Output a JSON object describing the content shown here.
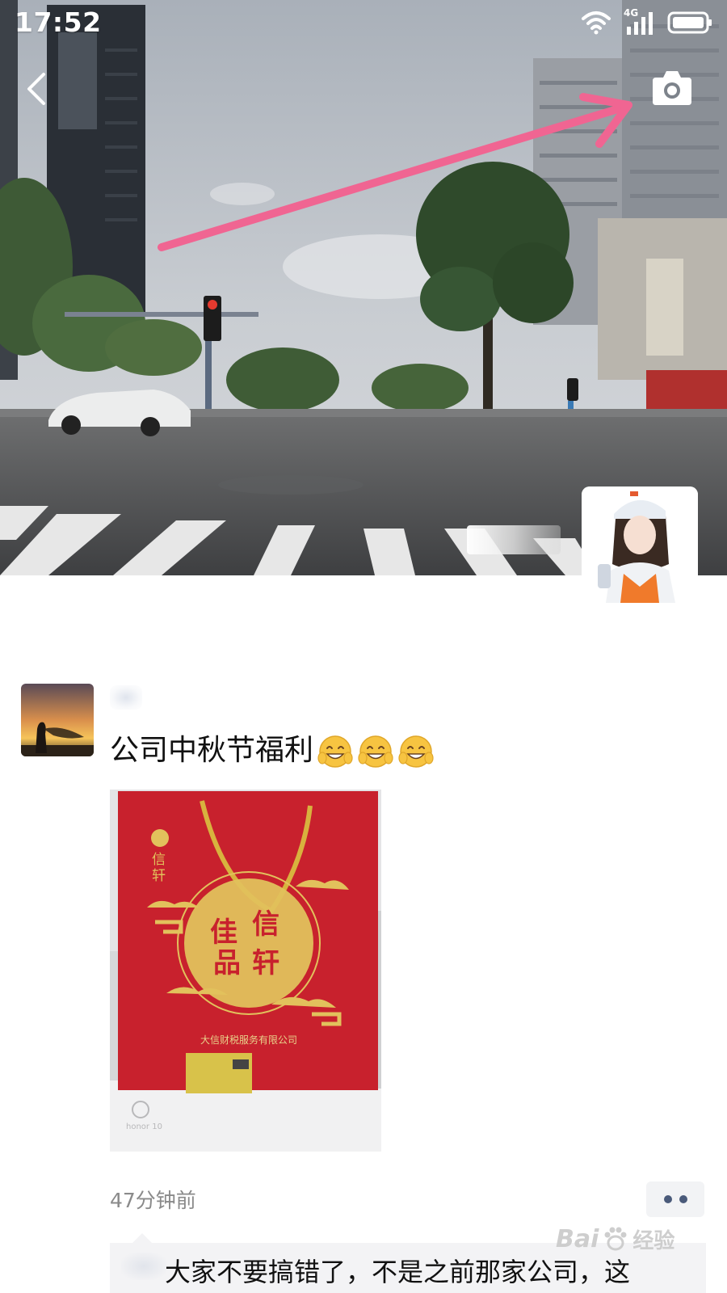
{
  "status_bar": {
    "time": "17:52",
    "network": "4G",
    "icons": [
      "wifi-icon",
      "signal-icon",
      "battery-icon"
    ]
  },
  "cover": {
    "back_icon": "chevron-left-icon",
    "camera_icon": "camera-icon",
    "annotation": "pink-arrow-pointing-to-camera"
  },
  "post": {
    "text": "公司中秋节福利",
    "emoji_icons": [
      "grin-sweat-emoji",
      "grin-sweat-emoji",
      "grin-sweat-emoji"
    ],
    "time_ago": "47分钟前",
    "image": {
      "bag_brand": "信轩",
      "bag_center": [
        "佳",
        "信",
        "品",
        "轩"
      ],
      "bag_company": "大信财税服务有限公司"
    },
    "comment_text": "大家不要搞错了，不是之前那家公司，这"
  },
  "watermark": {
    "brand": "Bai",
    "paw": "paw-icon",
    "suffix": "经验"
  },
  "colors": {
    "annotation_arrow": "#f06592",
    "bag_red": "#c8212d",
    "bag_gold": "#e2c15c",
    "timestamp_gray": "#8a8a8a",
    "more_dot": "#4a5a7a"
  }
}
